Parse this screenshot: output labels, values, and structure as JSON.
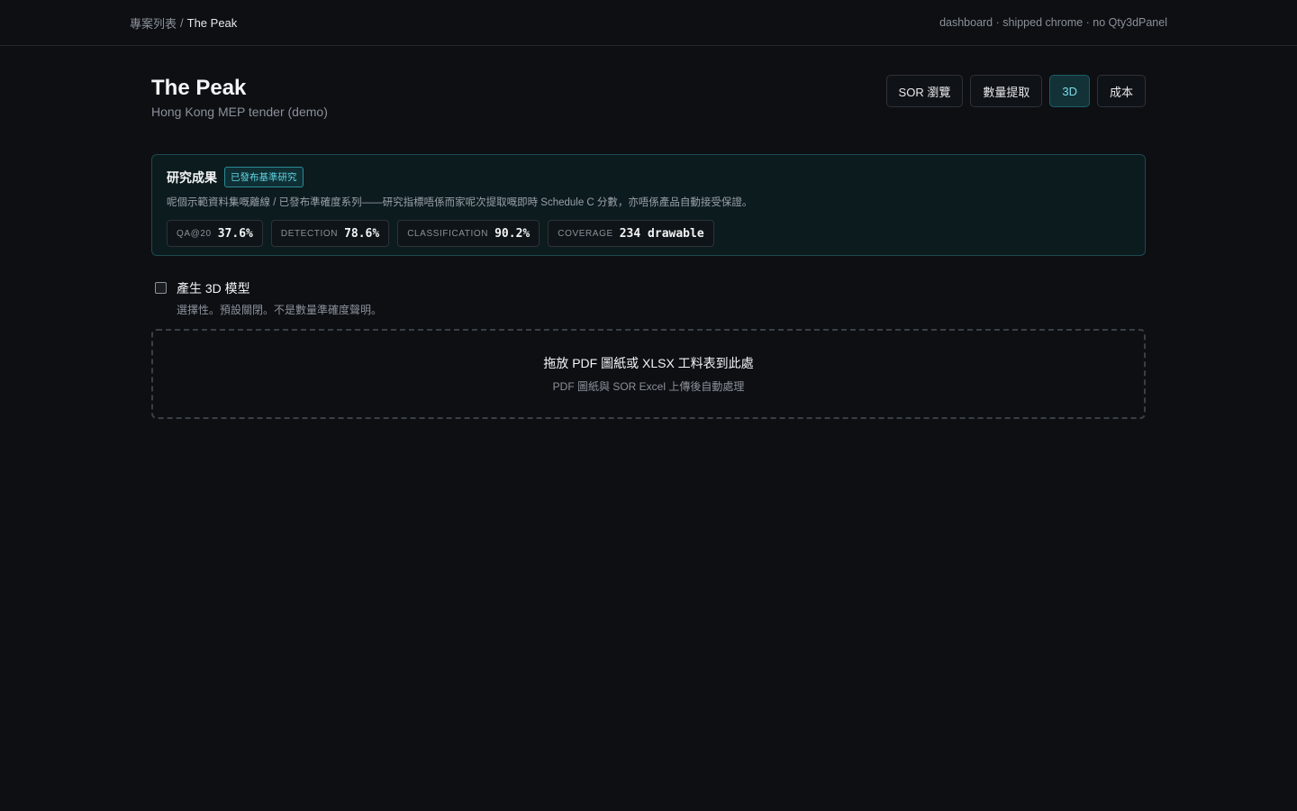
{
  "topbar": {
    "breadcrumb_root": "專案列表",
    "breadcrumb_sep": "/",
    "breadcrumb_current": "The Peak",
    "note": "dashboard · shipped chrome · no Qty3dPanel"
  },
  "header": {
    "title": "The Peak",
    "subtitle": "Hong Kong MEP tender (demo)",
    "buttons": [
      {
        "label": "SOR 瀏覽",
        "active": false
      },
      {
        "label": "數量提取",
        "active": false
      },
      {
        "label": "3D",
        "active": true
      },
      {
        "label": "成本",
        "active": false
      }
    ]
  },
  "research": {
    "title": "研究成果",
    "badge": "已發布基準研究",
    "description": "呢個示範資料集嘅離線 / 已發布準確度系列——研究指標唔係而家呢次提取嘅即時 Schedule C 分數，亦唔係產品自動接受保證。",
    "metrics": [
      {
        "label": "QA@20",
        "value": "37.6%"
      },
      {
        "label": "DETECTION",
        "value": "78.6%"
      },
      {
        "label": "CLASSIFICATION",
        "value": "90.2%"
      },
      {
        "label": "COVERAGE",
        "value": "234 drawable"
      }
    ]
  },
  "option": {
    "label": "產生 3D 模型",
    "hint": "選擇性。預設關閉。不是數量準確度聲明。",
    "checked": false
  },
  "dropzone": {
    "title": "拖放 PDF 圖紙或 XLSX 工料表到此處",
    "subtitle": "PDF 圖紙與 SOR Excel 上傳後自動處理"
  }
}
